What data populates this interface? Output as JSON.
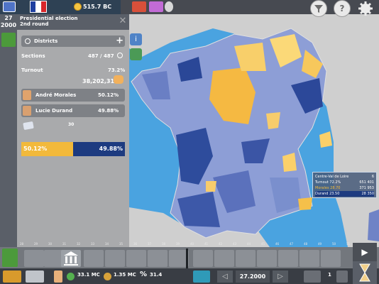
{
  "topbar": {
    "money": "515.7 BC",
    "date": "27",
    "year": "2000"
  },
  "panel": {
    "title": "Presidential election",
    "subtitle": "2nd round",
    "districts_label": "Districts",
    "sections_label": "Sections",
    "sections_value": "487 / 487",
    "turnout_label": "Turnout",
    "turnout_pct": "73.2%",
    "turnout_votes": "38,202,318",
    "candidates": [
      {
        "name": "André Morales",
        "pct": "50.12%"
      },
      {
        "name": "Lucie Durand",
        "pct": "49.88%"
      }
    ],
    "bar_top_label": "30",
    "bar": {
      "left_pct": "50.12%",
      "right_pct": "49.88%",
      "left_share": 0.5012
    }
  },
  "tooltip": {
    "region": "Centre-Val de Loire",
    "region_num": "6",
    "turnout_label": "Turnout",
    "turnout_pct": "72.2%",
    "turnout_votes": "651 401",
    "row1_name": "Morales",
    "row1_pct": "28.70",
    "row1_votes": "371 953",
    "row2_name": "Durand",
    "row2_pct": "23.50",
    "row2_votes": "28 350"
  },
  "timeline": {
    "numbers": [
      "28",
      "29",
      "30",
      "31",
      "32",
      "33",
      "34",
      "35",
      "36",
      "37",
      "38",
      "39",
      "40",
      "41",
      "42",
      "43",
      "44",
      "45",
      "46",
      "47",
      "48",
      "49",
      "50",
      "51"
    ]
  },
  "bottombar": {
    "money1": "33.1 MC",
    "money2": "1.35 MC",
    "pct": "31.4",
    "date": "27.2000",
    "count": "1"
  },
  "colors": {
    "orange": "#f2b93b",
    "navy": "#1d3b80"
  }
}
